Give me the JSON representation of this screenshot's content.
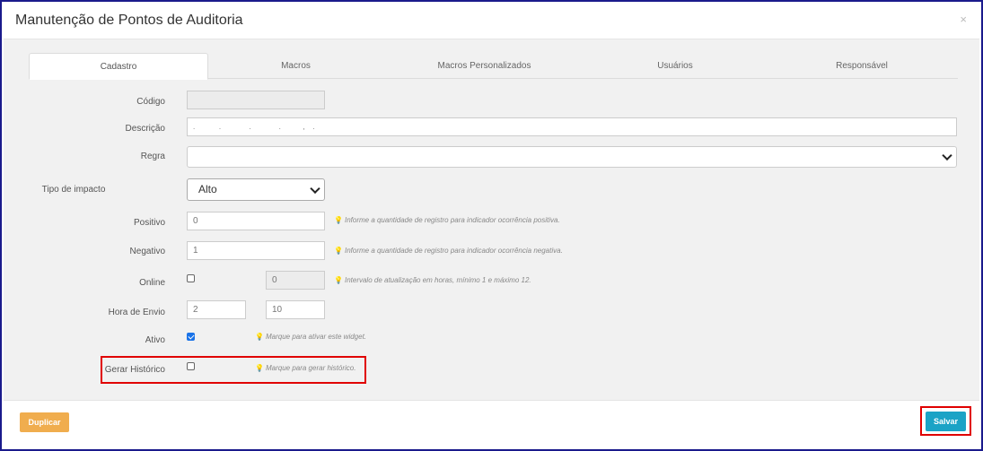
{
  "modal": {
    "title": "Manutenção de Pontos de Auditoria",
    "close_label": "×"
  },
  "tabs": [
    {
      "label": "Cadastro",
      "active": true
    },
    {
      "label": "Macros",
      "active": false
    },
    {
      "label": "Macros Personalizados",
      "active": false
    },
    {
      "label": "Usuários",
      "active": false
    },
    {
      "label": "Responsável",
      "active": false
    }
  ],
  "form": {
    "codigo": {
      "label": "Código",
      "value": ""
    },
    "descricao": {
      "label": "Descrição",
      "value": ".            .              .              .           ,    ."
    },
    "regra": {
      "label": "Regra",
      "value": ""
    },
    "tipo_impacto": {
      "label": "Tipo de impacto",
      "value": "Alto"
    },
    "positivo": {
      "label": "Positivo",
      "value": "0",
      "hint": "Informe a quantidade de registro para indicador ocorrência positiva."
    },
    "negativo": {
      "label": "Negativo",
      "value": "1",
      "hint": "Informe a quantidade de registro para indicador ocorrência negativa."
    },
    "online": {
      "label": "Online",
      "checked": false,
      "interval_value": "0",
      "hint": "Intervalo de atualização em horas, mínimo 1 e máximo 12."
    },
    "hora_envio": {
      "label": "Hora de Envio",
      "hour": "2",
      "minute": "10"
    },
    "ativo": {
      "label": "Ativo",
      "checked": true,
      "hint": "Marque para ativar este widget."
    },
    "gerar_historico": {
      "label": "Gerar Histórico",
      "checked": false,
      "hint": "Marque para gerar histórico."
    }
  },
  "footer": {
    "duplicar_label": "Duplicar",
    "salvar_label": "Salvar"
  },
  "colors": {
    "duplicar": "#f0ad4e",
    "salvar": "#1ba3c6",
    "highlight": "#e00000",
    "frame": "#1a1a8c"
  },
  "icons": {
    "hint": "lightbulb-icon",
    "close": "close-icon",
    "select": "chevron-down-icon"
  }
}
